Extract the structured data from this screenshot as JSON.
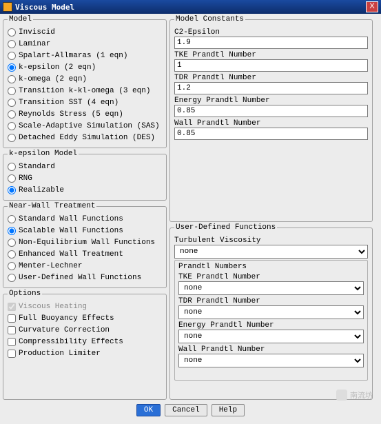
{
  "titlebar": {
    "title": "Viscous Model",
    "close": "X"
  },
  "model": {
    "legend": "Model",
    "options": [
      "Inviscid",
      "Laminar",
      "Spalart-Allmaras (1 eqn)",
      "k-epsilon (2 eqn)",
      "k-omega (2 eqn)",
      "Transition k-kl-omega (3 eqn)",
      "Transition SST (4 eqn)",
      "Reynolds Stress (5 eqn)",
      "Scale-Adaptive Simulation (SAS)",
      "Detached Eddy Simulation (DES)"
    ],
    "selected": 3
  },
  "keps_model": {
    "legend": "k-epsilon Model",
    "options": [
      "Standard",
      "RNG",
      "Realizable"
    ],
    "selected": 2
  },
  "near_wall": {
    "legend": "Near-Wall Treatment",
    "options": [
      "Standard Wall Functions",
      "Scalable Wall Functions",
      "Non-Equilibrium Wall Functions",
      "Enhanced Wall Treatment",
      "Menter-Lechner",
      "User-Defined Wall Functions"
    ],
    "selected": 1
  },
  "options": {
    "legend": "Options",
    "items": [
      {
        "label": "Viscous Heating",
        "checked": true,
        "disabled": true
      },
      {
        "label": "Full Buoyancy Effects",
        "checked": false,
        "disabled": false
      },
      {
        "label": "Curvature Correction",
        "checked": false,
        "disabled": false
      },
      {
        "label": "Compressibility Effects",
        "checked": false,
        "disabled": false
      },
      {
        "label": "Production Limiter",
        "checked": false,
        "disabled": false
      }
    ]
  },
  "constants": {
    "legend": "Model Constants",
    "fields": [
      {
        "label": "C2-Epsilon",
        "value": "1.9"
      },
      {
        "label": "TKE Prandtl Number",
        "value": "1"
      },
      {
        "label": "TDR Prandtl Number",
        "value": "1.2"
      },
      {
        "label": "Energy Prandtl Number",
        "value": "0.85"
      },
      {
        "label": "Wall Prandtl Number",
        "value": "0.85"
      }
    ]
  },
  "udf": {
    "legend": "User-Defined Functions",
    "turb_visc": {
      "label": "Turbulent Viscosity",
      "value": "none"
    },
    "prandtl": {
      "legend": "Prandtl Numbers",
      "fields": [
        {
          "label": "TKE Prandtl Number",
          "value": "none"
        },
        {
          "label": "TDR Prandtl Number",
          "value": "none"
        },
        {
          "label": "Energy Prandtl Number",
          "value": "none"
        },
        {
          "label": "Wall Prandtl Number",
          "value": "none"
        }
      ]
    }
  },
  "buttons": {
    "ok": "OK",
    "cancel": "Cancel",
    "help": "Help"
  },
  "watermark": "南流坊"
}
